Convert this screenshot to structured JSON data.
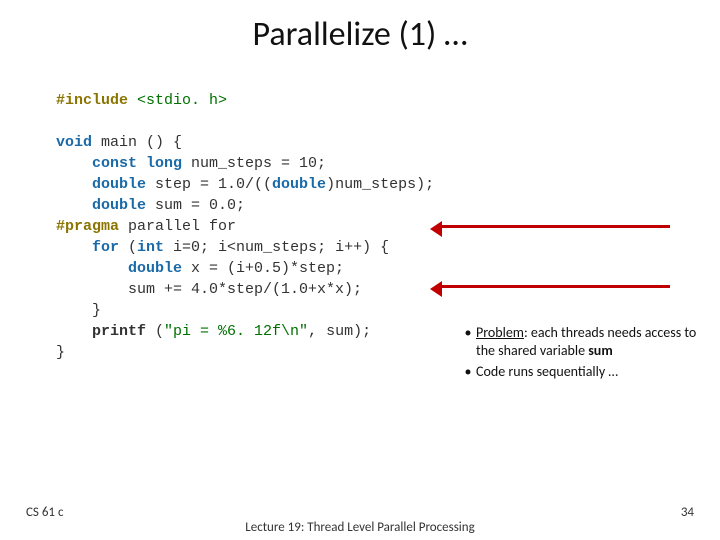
{
  "title": "Parallelize (1) …",
  "code": {
    "l1a": "#include",
    "l1b": " <stdio. h>",
    "l3a": "void",
    "l3b": " main () {",
    "l4a": "    const long",
    "l4b": " num_steps = 10;",
    "l5a": "    double",
    "l5b": " step = 1.0/((",
    "l5c": "double",
    "l5d": ")num_steps);",
    "l6a": "    double",
    "l6b": " sum = 0.0;",
    "l7a": "#pragma",
    "l7b": " parallel for",
    "l8a": "    for",
    "l8b": " (",
    "l8c": "int",
    "l8d": " i=0; i<num_steps; i++) {",
    "l9a": "        double",
    "l9b": " x = (i+0.5)*step;",
    "l10": "        sum += 4.0*step/(1.0+x*x);",
    "l11": "    }",
    "l12a": "    printf",
    "l12b": " (",
    "l12c": "\"pi = %6. 12f\\n\"",
    "l12d": ", sum);",
    "l13": "}"
  },
  "notes": {
    "b1_pre": "Problem",
    "b1_post": ": each threads needs access to the shared variable ",
    "b1_bold": "sum",
    "b2": "Code runs sequentially …"
  },
  "footer": {
    "left": "CS 61 c",
    "center": "Lecture 19: Thread Level Parallel Processing",
    "right": "34"
  }
}
